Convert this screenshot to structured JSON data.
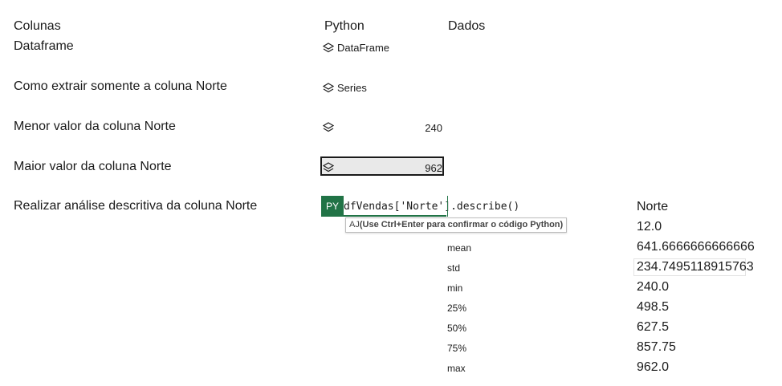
{
  "headers": {
    "col1": "Colunas",
    "col2": "Python",
    "col3": "Dados"
  },
  "rows": [
    {
      "label": "Dataframe",
      "python_text": "DataFrame",
      "value": ""
    },
    {
      "label": "Como extrair somente a coluna Norte",
      "python_text": "Series",
      "value": ""
    },
    {
      "label": "Menor valor da coluna Norte",
      "python_text": "",
      "value": "240"
    },
    {
      "label": "Maior valor da coluna Norte",
      "python_text": "",
      "value": "962"
    },
    {
      "label": "Realizar análise descritiva da coluna Norte",
      "python_text": "",
      "value": ""
    }
  ],
  "formula_bar": {
    "badge": "PY",
    "code_prefix": "dfVendas[",
    "code_string": "'Norte'",
    "code_suffix": "].describe()",
    "tooltip_prefix": "AJ",
    "tooltip_bold": "(Use Ctrl+Enter para confirmar o código Python)"
  },
  "describe": {
    "header": "Norte",
    "rows": [
      {
        "label": "",
        "value": "12.0"
      },
      {
        "label": "mean",
        "value": "641.6666666666666"
      },
      {
        "label": "std",
        "value": "234.7495118915763"
      },
      {
        "label": "min",
        "value": "240.0"
      },
      {
        "label": "25%",
        "value": "498.5"
      },
      {
        "label": "50%",
        "value": "627.5"
      },
      {
        "label": "75%",
        "value": "857.75"
      },
      {
        "label": "max",
        "value": "962.0"
      }
    ]
  },
  "icons": {
    "python_object": "stack-layers-icon"
  },
  "colors": {
    "python_green": "#217346",
    "selection_border": "#1a1a1a"
  }
}
